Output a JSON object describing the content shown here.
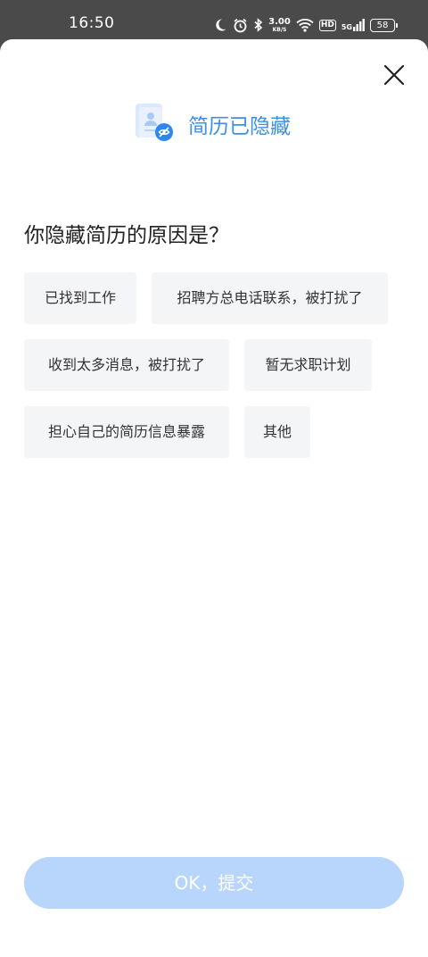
{
  "status_bar": {
    "time": "16:50",
    "speed_value": "3.00",
    "speed_unit": "KB/S",
    "hd": "HD",
    "network": "5G",
    "battery": "58",
    "icons": [
      "moon-icon",
      "alarm-icon",
      "bluetooth-icon",
      "wifi-icon",
      "signal-icon",
      "battery-icon"
    ]
  },
  "sheet": {
    "title": "简历已隐藏",
    "question": "你隐藏简历的原因是？",
    "options": [
      "已找到工作",
      "招聘方总电话联系，被打扰了",
      "收到太多消息，被打扰了",
      "暂无求职计划",
      "担心自己的简历信息暴露",
      "其他"
    ],
    "submit_label": "OK，提交",
    "colors": {
      "accent": "#3d8fe8",
      "submit_disabled": "#b8d5fb",
      "option_bg": "#f4f5f7"
    }
  }
}
